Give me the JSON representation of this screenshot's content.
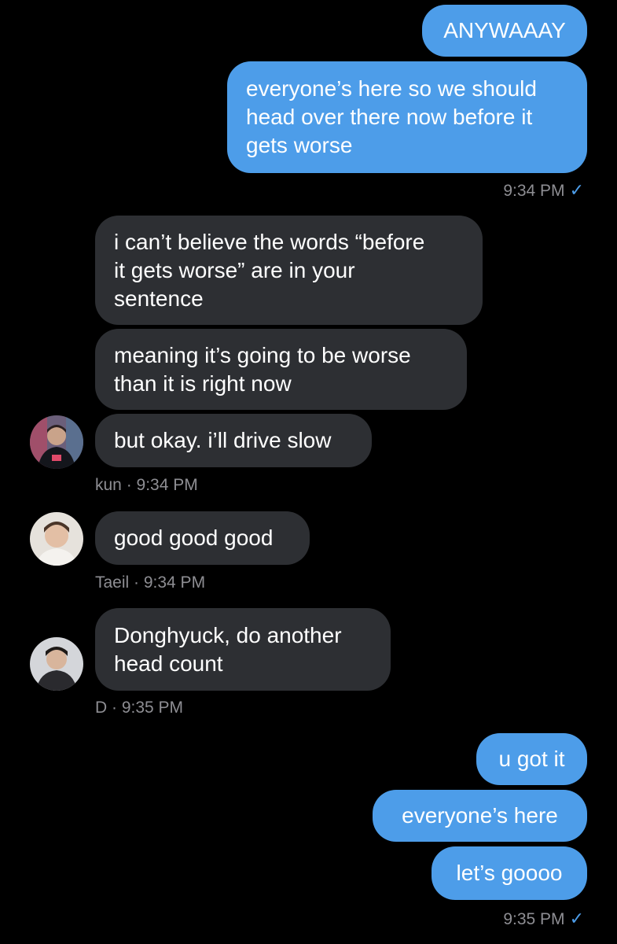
{
  "colors": {
    "background": "#000000",
    "outgoing_bubble": "#4d9de9",
    "incoming_bubble": "#2d2f33",
    "meta_text": "#8e8e93",
    "read_check": "#4d9de9"
  },
  "messages": {
    "m1": "ANYWAAAY",
    "m2": "everyone’s here so we should\nhead over there now before it\ngets worse",
    "m3": "i can’t believe the words “before\nit gets worse” are in your\nsentence",
    "m4": "meaning it’s going to be worse\nthan it is right now",
    "m5": "but okay. i’ll drive slow",
    "m6": "good good good",
    "m7": "Donghyuck, do another\nhead count",
    "m8": "u got it",
    "m9": "everyone’s here",
    "m10": "let’s goooo"
  },
  "meta": {
    "sent1_time": "9:34 PM",
    "kun_meta": "kun · 9:34 PM",
    "taeil_meta": "Taeil · 9:34 PM",
    "d_meta": "D · 9:35 PM",
    "sent2_time": "9:35 PM",
    "read_check_icon": "checkmark-icon",
    "check_glyph": "✓"
  },
  "avatars": {
    "kun": "avatar-kun",
    "taeil": "avatar-taeil",
    "d": "avatar-d"
  }
}
